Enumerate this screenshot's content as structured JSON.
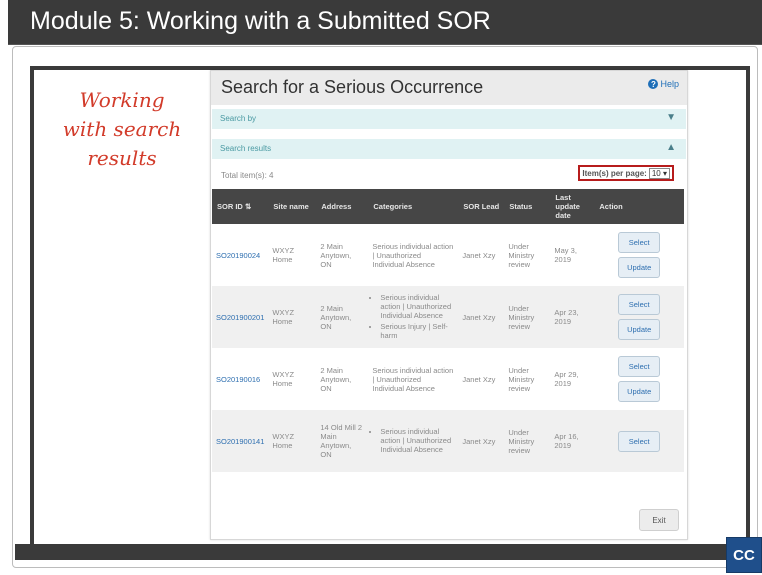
{
  "module_title": "Module 5:  Working with a Submitted SOR",
  "annotation": {
    "lines": [
      "Working",
      "with search",
      "results"
    ]
  },
  "cc_label": "CC",
  "app": {
    "title": "Search for a Serious Occurrence",
    "help_label": "Help",
    "search_by_label": "Search by",
    "search_results_label": "Search results",
    "total_items": "Total item(s): 4",
    "per_page_label": "Item(s) per page:",
    "per_page_value": "10",
    "exit_label": "Exit"
  },
  "table": {
    "headers": [
      "SOR ID",
      "Site name",
      "Address",
      "Categories",
      "SOR Lead",
      "Status",
      "Last update date",
      "Action"
    ],
    "rows": [
      {
        "sor_id": "SO20190024",
        "site_name": "WXYZ Home",
        "address": "2 Main Anytown, ON",
        "categories": [
          "Serious individual action | Unauthorized Individual Absence"
        ],
        "lead": "Janet Xzy",
        "status": "Under Ministry review",
        "date": "May 3, 2019",
        "actions": [
          "Select",
          "Update"
        ]
      },
      {
        "sor_id": "SO201900201",
        "site_name": "WXYZ Home",
        "address": "2 Main Anytown, ON",
        "categories": [
          "Serious individual action | Unauthorized Individual Absence",
          "Serious Injury | Self-harm"
        ],
        "lead": "Janet Xzy",
        "status": "Under Ministry review",
        "date": "Apr 23, 2019",
        "actions": [
          "Select",
          "Update"
        ]
      },
      {
        "sor_id": "SO20190016",
        "site_name": "WXYZ Home",
        "address": "2 Main Anytown, ON",
        "categories": [
          "Serious individual action | Unauthorized Individual Absence"
        ],
        "lead": "Janet Xzy",
        "status": "Under Ministry review",
        "date": "Apr 29, 2019",
        "actions": [
          "Select",
          "Update"
        ]
      },
      {
        "sor_id": "SO201900141",
        "site_name": "WXYZ Home",
        "address": "14 Old Mill 2 Main Anytown, ON",
        "categories": [
          "Serious individual action | Unauthorized Individual Absence"
        ],
        "lead": "Janet Xzy",
        "status": "Under Ministry review",
        "date": "Apr 16, 2019",
        "actions": [
          "Select"
        ]
      }
    ]
  },
  "colors": {
    "header_bar": "#3a3a3a",
    "accent": "#2e6fb0",
    "annotation": "#d23b2a",
    "highlight": "#b71c1c"
  }
}
